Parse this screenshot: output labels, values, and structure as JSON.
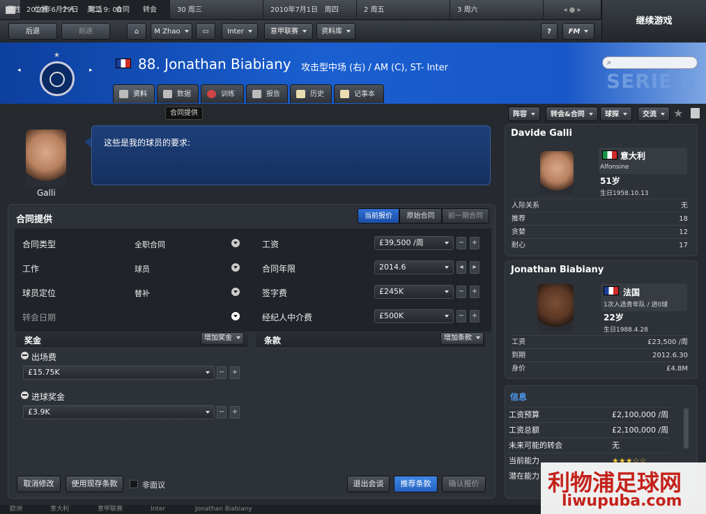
{
  "datebar": {
    "current": "2010年6月29日",
    "weekday": "周二",
    "time": "9: 00",
    "d1": "30",
    "d1w": "周三",
    "d2": "2010年7月1日",
    "d2w": "周四",
    "d3": "2",
    "d3w": "周五",
    "d4": "3",
    "d4w": "周六"
  },
  "continue_label": "继续游戏",
  "toolbar": {
    "back": "后退",
    "forward": "前进",
    "manager": "M Zhao",
    "club": "Inter",
    "league": "意甲联赛",
    "database": "资料库",
    "help": "?",
    "fm": "FM"
  },
  "player": {
    "title": "88. Jonathan Biabiany",
    "positions": "攻击型中场 (右) / AM (C), ST- Inter",
    "league_logo": "SERIE A"
  },
  "tabs": [
    "资料",
    "数据",
    "训练",
    "报告",
    "历史",
    "记事本"
  ],
  "subnav": [
    "属性",
    "位置",
    "个人",
    "对话",
    "合同",
    "转会",
    "合同提供"
  ],
  "right_menu": [
    "阵容",
    "转会&合同",
    "球探",
    "交流"
  ],
  "agent": {
    "name": "Galli",
    "message": "这些是我的球员的要求:"
  },
  "panel": {
    "title": "合同提供",
    "seg": [
      "当前报价",
      "原始合同",
      "前一期合同"
    ],
    "rows_left": [
      {
        "label": "合同类型",
        "value": "全职合同"
      },
      {
        "label": "工作",
        "value": "球员"
      },
      {
        "label": "球员定位",
        "value": "替补"
      },
      {
        "label": "转会日期",
        "value": ""
      }
    ],
    "rows_right": [
      {
        "label": "工资",
        "value": "£39,500 /周"
      },
      {
        "label": "合同年限",
        "value": "2014.6"
      },
      {
        "label": "签字费",
        "value": "£245K"
      },
      {
        "label": "经纪人中介费",
        "value": "£500K"
      }
    ],
    "bonus_title": "奖金",
    "add_bonus": "增加奖金",
    "clauses_title": "条款",
    "add_clause": "增加条款",
    "bonus_items": [
      {
        "name": "出场费",
        "value": "£15.75K"
      },
      {
        "name": "进球奖金",
        "value": "£3.9K"
      }
    ],
    "buttons": {
      "cancel": "取消修改",
      "use_existing": "使用现存条款",
      "non_negotiable": "非面议",
      "leave": "退出会谈",
      "suggest": "推荐条款",
      "confirm": "确认报价"
    }
  },
  "agent_card": {
    "name": "Davide Galli",
    "nation": "意大利",
    "city": "Alfonsine",
    "age": "51岁",
    "birth": "生日1958.10.13",
    "rows": [
      {
        "k": "人际关系",
        "v": "无"
      },
      {
        "k": "推荐",
        "v": "18"
      },
      {
        "k": "贪婪",
        "v": "12"
      },
      {
        "k": "耐心",
        "v": "17"
      }
    ]
  },
  "player_card": {
    "name": "Jonathan Biabiany",
    "nation": "法国",
    "caps": "1次入选青年队 / 进0球",
    "age": "22岁",
    "birth": "生日1988.4.28",
    "rows": [
      {
        "k": "工资",
        "v": "£23,500 /周"
      },
      {
        "k": "到期",
        "v": "2012.6.30"
      },
      {
        "k": "身价",
        "v": "£4.8M"
      }
    ]
  },
  "info_card": {
    "title": "信息",
    "rows": [
      {
        "k": "工资预算",
        "v": "£2,100,000 /周"
      },
      {
        "k": "工资总额",
        "v": "£2,100,000 /周"
      },
      {
        "k": "未来可能的转会",
        "v": "无"
      },
      {
        "k": "当前能力",
        "v": ""
      },
      {
        "k": "潜在能力",
        "v": ""
      }
    ]
  },
  "breadcrumb": [
    "欧洲",
    "意大利",
    "意甲联赛",
    "Inter",
    "Jonathan Biabiany"
  ],
  "watermark": {
    "line1": "利物浦足球网",
    "line2": "liwupuba.com"
  },
  "colors": {
    "accent": "#1a5fd0",
    "active": "#2a6ad6"
  }
}
